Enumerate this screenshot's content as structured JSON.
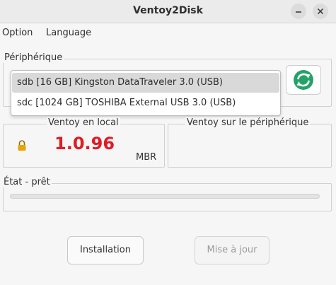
{
  "window": {
    "title": "Ventoy2Disk"
  },
  "menu": {
    "option": "Option",
    "language": "Language"
  },
  "device": {
    "group_label": "Périphérique",
    "options": [
      "sdb  [16 GB]  Kingston DataTraveler 3.0 (USB)",
      "sdc  [1024 GB]  TOSHIBA External USB 3.0 (USB)"
    ]
  },
  "local": {
    "label": "Ventoy en local",
    "version": "1.0.96",
    "partition_style": "MBR"
  },
  "remote": {
    "label": "Ventoy sur le périphérique"
  },
  "status": {
    "label": "État - prêt",
    "progress": 0
  },
  "buttons": {
    "install": "Installation",
    "update": "Mise à jour"
  },
  "colors": {
    "version": "#e01b24",
    "refresh_icon": "#26a269",
    "lock": "#e5a50a"
  },
  "icons": {
    "refresh": "refresh-icon",
    "lock": "lock-icon"
  }
}
